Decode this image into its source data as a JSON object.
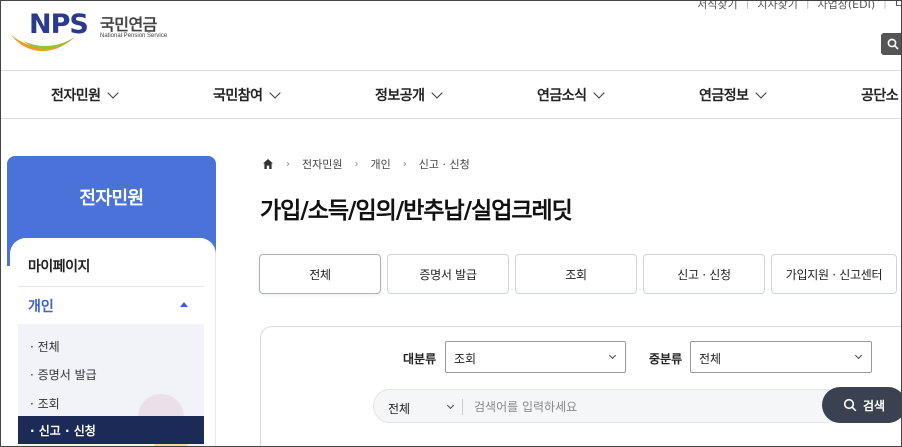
{
  "header": {
    "logo_text": "NPS",
    "logo_korean": "국민연금",
    "logo_english": "National Pension Service",
    "utility_links": [
      "서식찾기",
      "지사찾기",
      "사업장(EDI)",
      "L"
    ]
  },
  "gnb": {
    "items": [
      "전자민원",
      "국민참여",
      "정보공개",
      "연금소식",
      "연금정보",
      "공단소"
    ]
  },
  "sidebar": {
    "title": "전자민원",
    "mypage": "마이페이지",
    "section": "개인",
    "sub_items": [
      "전체",
      "증명서 발급",
      "조회",
      "신고 · 신청"
    ]
  },
  "breadcrumb": [
    "전자민원",
    "개인",
    "신고 · 신청"
  ],
  "page_title": "가입/소득/임의/반추납/실업크레딧",
  "tabs": [
    "전체",
    "증명서 발급",
    "조회",
    "신고 · 신청",
    "가입지원 · 신고센터"
  ],
  "search": {
    "major_label": "대분류",
    "major_value": "조회",
    "minor_label": "중분류",
    "minor_value": "전체",
    "scope_value": "전체",
    "placeholder": "검색어를 입력하세요",
    "button_label": "검색"
  },
  "colors": {
    "brand_blue": "#4a72d8",
    "active_nav": "#1c2a58",
    "logo_navy": "#2a3a8c",
    "search_button": "#3a4252"
  }
}
